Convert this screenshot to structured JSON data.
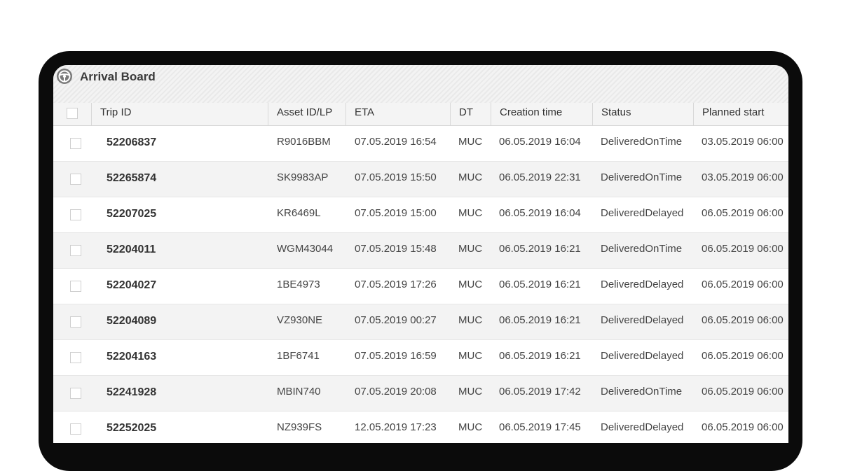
{
  "window": {
    "title": "Arrival Board",
    "icon": "steering-wheel-icon"
  },
  "table": {
    "columns": [
      "Trip ID",
      "Asset ID/LP",
      "ETA",
      "DT",
      "Creation time",
      "Status",
      "Planned start"
    ],
    "rows": [
      {
        "trip_id": "52206837",
        "asset": "R9016BBM",
        "eta": "07.05.2019 16:54",
        "dt": "MUC",
        "created": "06.05.2019 16:04",
        "status": "DeliveredOnTime",
        "planned": "03.05.2019 06:00"
      },
      {
        "trip_id": "52265874",
        "asset": "SK9983AP",
        "eta": "07.05.2019 15:50",
        "dt": "MUC",
        "created": "06.05.2019 22:31",
        "status": "DeliveredOnTime",
        "planned": "03.05.2019 06:00"
      },
      {
        "trip_id": "52207025",
        "asset": "KR6469L",
        "eta": "07.05.2019 15:00",
        "dt": "MUC",
        "created": "06.05.2019 16:04",
        "status": "DeliveredDelayed",
        "planned": "06.05.2019 06:00"
      },
      {
        "trip_id": "52204011",
        "asset": "WGM43044",
        "eta": "07.05.2019 15:48",
        "dt": "MUC",
        "created": "06.05.2019 16:21",
        "status": "DeliveredOnTime",
        "planned": "06.05.2019 06:00"
      },
      {
        "trip_id": "52204027",
        "asset": "1BE4973",
        "eta": "07.05.2019 17:26",
        "dt": "MUC",
        "created": "06.05.2019 16:21",
        "status": "DeliveredDelayed",
        "planned": "06.05.2019 06:00"
      },
      {
        "trip_id": "52204089",
        "asset": "VZ930NE",
        "eta": "07.05.2019 00:27",
        "dt": "MUC",
        "created": "06.05.2019 16:21",
        "status": "DeliveredDelayed",
        "planned": "06.05.2019 06:00"
      },
      {
        "trip_id": "52204163",
        "asset": "1BF6741",
        "eta": "07.05.2019 16:59",
        "dt": "MUC",
        "created": "06.05.2019 16:21",
        "status": "DeliveredDelayed",
        "planned": "06.05.2019 06:00"
      },
      {
        "trip_id": "52241928",
        "asset": "MBIN740",
        "eta": "07.05.2019 20:08",
        "dt": "MUC",
        "created": "06.05.2019 17:42",
        "status": "DeliveredOnTime",
        "planned": "06.05.2019 06:00"
      },
      {
        "trip_id": "52252025",
        "asset": "NZ939FS",
        "eta": "12.05.2019 17:23",
        "dt": "MUC",
        "created": "06.05.2019 17:45",
        "status": "DeliveredDelayed",
        "planned": "06.05.2019 06:00"
      }
    ]
  }
}
